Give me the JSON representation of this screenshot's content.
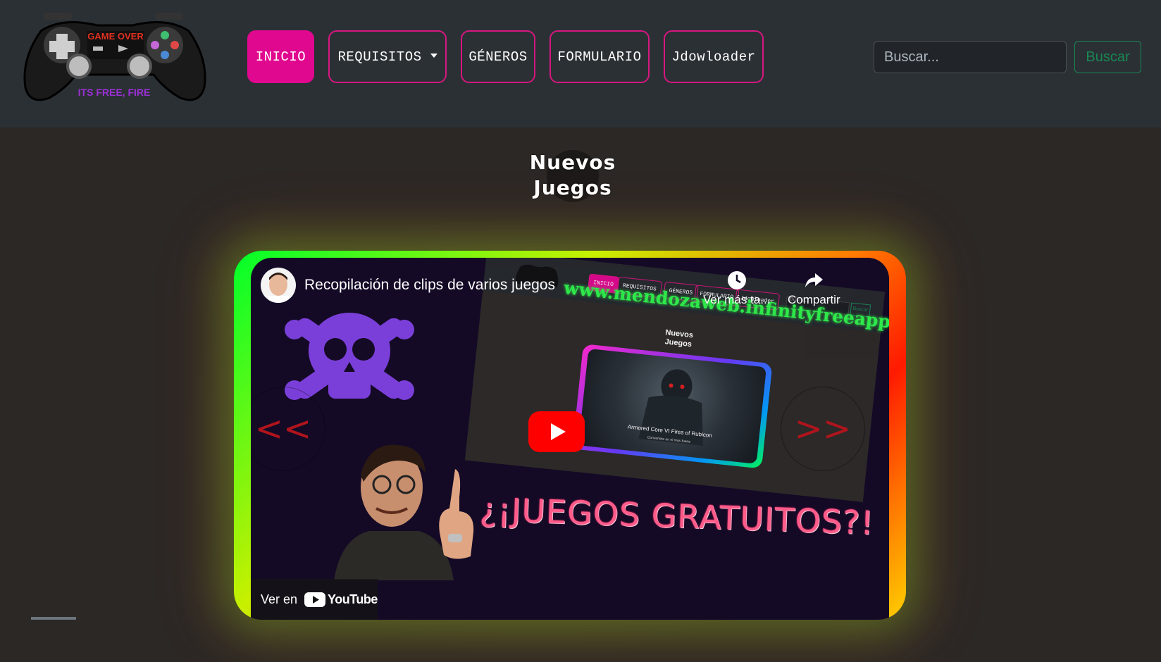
{
  "nav": {
    "logo": {
      "top_text": "GAME OVER",
      "bottom_text": "ITS FREE, FIRE"
    },
    "items": [
      {
        "label": "INICIO",
        "active": true
      },
      {
        "label": "REQUISITOS",
        "dropdown": true
      },
      {
        "label": "GÉNEROS"
      },
      {
        "label": "FORMULARIO"
      },
      {
        "label": "Jdowloader"
      }
    ],
    "search": {
      "placeholder": "Buscar...",
      "button_label": "Buscar"
    }
  },
  "section": {
    "title_line1": "Nuevos",
    "title_line2": "Juegos"
  },
  "carousel": {
    "prev_label": "<<",
    "next_label": ">>",
    "video": {
      "title": "Recopilación de clips de varios juegos",
      "watermark": "www.mendozaweb.infinityfreeapp.com",
      "watch_later_label": "Ver más ta...",
      "share_label": "Compartir",
      "watch_on_label": "Ver en",
      "youtube_label": "YouTube",
      "promo_text": "¿¡JUEGOS GRATUITOS?!",
      "thumbnail": {
        "nav": [
          "INICIO",
          "REQUISITOS",
          "GÉNEROS",
          "FORMULARIO",
          "Jdowloader"
        ],
        "search_placeholder": "Buscar...",
        "search_button": "Buscar",
        "heading_line1": "Nuevos",
        "heading_line2": "Juegos",
        "caption": "Armored Core VI Fires of Rubicon",
        "subcaption": "Convertete en el mas fuerte"
      }
    }
  },
  "colors": {
    "nav_bg": "#2b3035",
    "page_bg": "#2c2826",
    "accent_pink": "#e0088f",
    "search_green": "#198754",
    "arrow_red": "#b0141c"
  }
}
